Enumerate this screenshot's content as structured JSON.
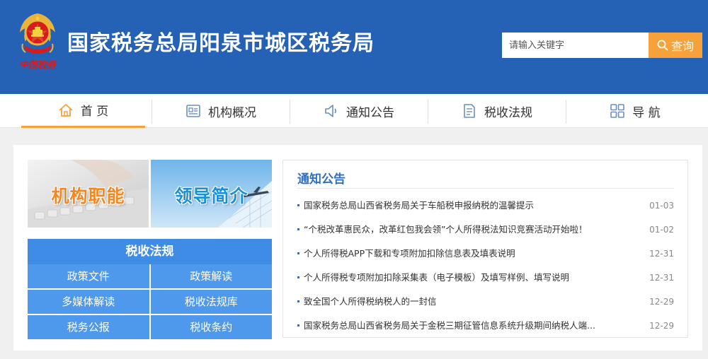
{
  "header": {
    "title": "国家税务总局阳泉市城区税务局",
    "logo_text": "中国税务",
    "search": {
      "placeholder": "请输入关键字",
      "button_label": "查询"
    }
  },
  "nav": {
    "items": [
      {
        "label": "首 页",
        "icon": "home-icon",
        "active": true
      },
      {
        "label": "机构概况",
        "icon": "org-profile-icon",
        "active": false
      },
      {
        "label": "通知公告",
        "icon": "speaker-icon",
        "active": false
      },
      {
        "label": "税收法规",
        "icon": "document-icon",
        "active": false
      },
      {
        "label": "导 航",
        "icon": "grid-icon",
        "active": false
      }
    ]
  },
  "banners": [
    {
      "label": "机构职能"
    },
    {
      "label": "领导简介"
    }
  ],
  "tax_regulations": {
    "title": "税收法规",
    "links": [
      "政策文件",
      "政策解读",
      "多媒体解读",
      "税收法规库",
      "税务公报",
      "税收条约"
    ]
  },
  "notices": {
    "title": "通知公告",
    "items": [
      {
        "text": "国家税务总局山西省税务局关于车船税申报纳税的温馨提示",
        "date": "01-03"
      },
      {
        "text": "“个税改革惠民众，改革红包我会领”个人所得税法知识竞赛活动开始啦！",
        "date": "01-02"
      },
      {
        "text": "个人所得税APP下载和专项附加扣除信息表及填表说明",
        "date": "12-31"
      },
      {
        "text": "个人所得税专项附加扣除采集表（电子模板）及填写样例、填写说明",
        "date": "12-31"
      },
      {
        "text": "致全国个人所得税纳税人的一封信",
        "date": "12-29"
      },
      {
        "text": "国家税务总局山西省税务局关于金税三期征管信息系统升级期间纳税人端...",
        "date": "12-29"
      }
    ]
  },
  "colors": {
    "header_bg": "#2561b4",
    "accent_orange": "#f7a13a",
    "link_blue": "#2f6fc5",
    "tile_blue": "#4e99ec",
    "logo_red": "#d61c1c",
    "logo_gold": "#e9b43a"
  }
}
